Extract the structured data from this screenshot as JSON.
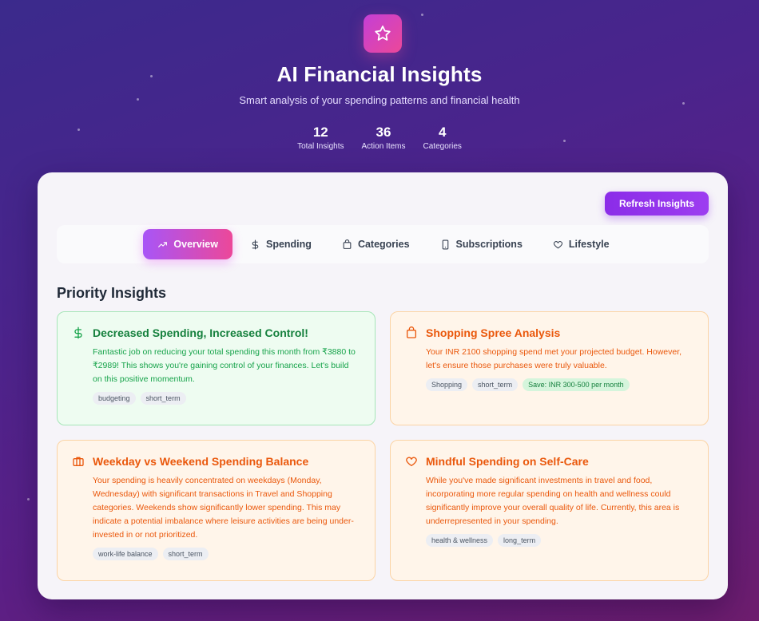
{
  "header": {
    "logo_icon": "star-icon",
    "title": "AI Financial Insights",
    "subtitle": "Smart analysis of your spending patterns and financial health",
    "stats": [
      {
        "value": "12",
        "label": "Total Insights"
      },
      {
        "value": "36",
        "label": "Action Items"
      },
      {
        "value": "4",
        "label": "Categories"
      }
    ]
  },
  "toolbar": {
    "refresh_label": "Refresh Insights"
  },
  "tabs": [
    {
      "label": "Overview",
      "icon": "trend-up-icon",
      "active": true
    },
    {
      "label": "Spending",
      "icon": "dollar-icon"
    },
    {
      "label": "Categories",
      "icon": "shopping-bag-icon"
    },
    {
      "label": "Subscriptions",
      "icon": "phone-icon"
    },
    {
      "label": "Lifestyle",
      "icon": "heart-icon"
    }
  ],
  "section_title": "Priority Insights",
  "insights": [
    {
      "icon": "dollar-icon",
      "title": "Decreased Spending, Increased Control!",
      "text": "Fantastic job on reducing your total spending this month from ₹3880 to ₹2989! This shows you're gaining control of your finances. Let's build on this positive momentum.",
      "tags": [
        "budgeting",
        "short_term"
      ]
    },
    {
      "icon": "shopping-bag-icon",
      "title": "Shopping Spree Analysis",
      "text": "Your INR 2100 shopping spend met your projected budget. However, let's ensure those purchases were truly valuable.",
      "tags": [
        "Shopping",
        "short_term"
      ],
      "save": "Save: INR 300-500 per month"
    },
    {
      "icon": "briefcase-icon",
      "title": "Weekday vs Weekend Spending Balance",
      "text": "Your spending is heavily concentrated on weekdays (Monday, Wednesday) with significant transactions in Travel and Shopping categories. Weekends show significantly lower spending. This may indicate a potential imbalance where leisure activities are being under-invested in or not prioritized.",
      "tags": [
        "work-life balance",
        "short_term"
      ]
    },
    {
      "icon": "heart-icon",
      "title": "Mindful Spending on Self-Care",
      "text": "While you've made significant investments in travel and food, incorporating more regular spending on health and wellness could significantly improve your overall quality of life. Currently, this area is underrepresented in your spending.",
      "tags": [
        "health & wellness",
        "long_term"
      ]
    }
  ],
  "colors": {
    "accent": "#a855f7",
    "pink": "#ec4899",
    "success": "#16a34a",
    "warning": "#ea580c"
  }
}
